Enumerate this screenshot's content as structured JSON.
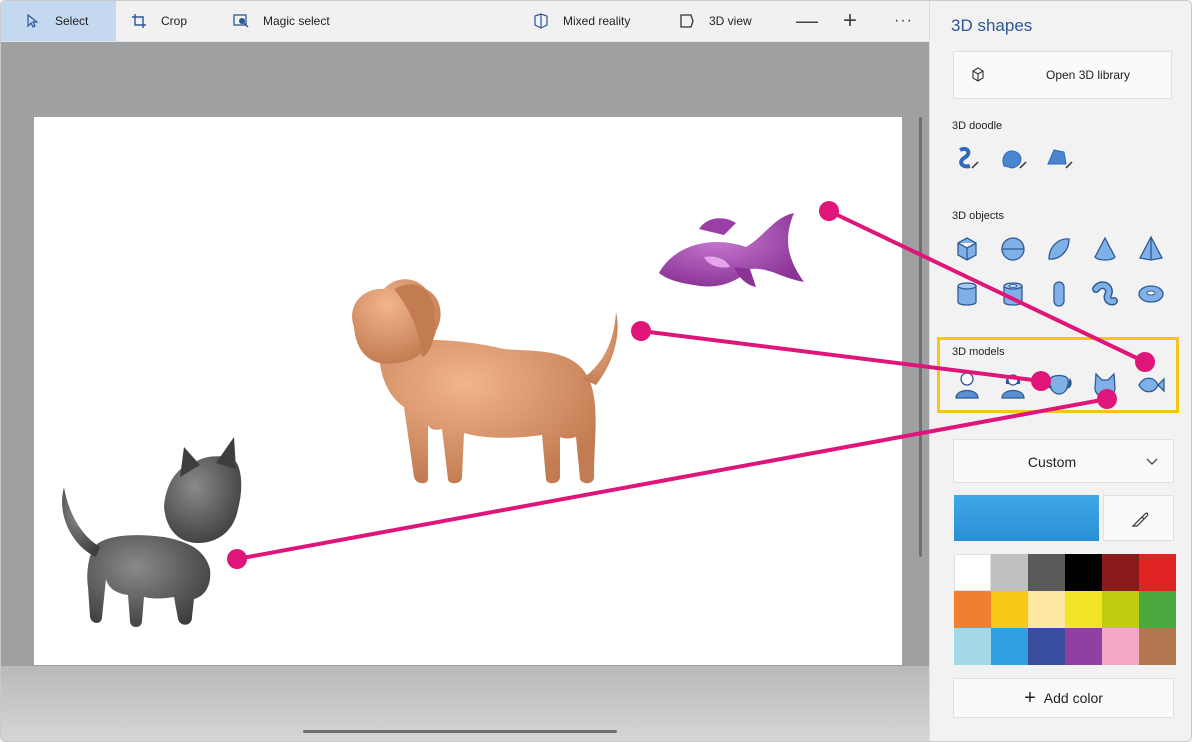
{
  "toolbar": {
    "select_label": "Select",
    "crop_label": "Crop",
    "magic_select_label": "Magic select",
    "mixed_reality_label": "Mixed reality",
    "view_3d_label": "3D view",
    "zoom_out_label": "—",
    "zoom_in_label": "+",
    "more_label": "···"
  },
  "panel": {
    "title": "3D shapes",
    "open_library_label": "Open 3D library",
    "section_doodle": "3D doodle",
    "section_objects": "3D objects",
    "section_models": "3D models",
    "doodle_items": [
      "sharp-doodle-icon",
      "soft-doodle-icon",
      "tube-doodle-icon"
    ],
    "object_items": [
      "cube-icon",
      "sphere-icon",
      "hemisphere-icon",
      "cone-icon",
      "pyramid-icon",
      "cylinder-icon",
      "tube-icon",
      "capsule-icon",
      "curved-tube-icon",
      "donut-icon"
    ],
    "model_items": [
      "man-model-icon",
      "woman-model-icon",
      "dog-model-icon",
      "cat-model-icon",
      "fish-model-icon"
    ],
    "color_mode": "Custom",
    "current_color": "#2a8fd6",
    "palette": [
      "#ffffff",
      "#c0c0c0",
      "#5a5a5a",
      "#000000",
      "#8b1a1a",
      "#e02424",
      "#f08030",
      "#f8c818",
      "#fce8a0",
      "#f4e428",
      "#c0cc10",
      "#4aaa40",
      "#a4d8e4",
      "#30a0e0",
      "#3a4ea0",
      "#9040a0",
      "#f4a8c8",
      "#b47850"
    ],
    "add_color_label": "Add color"
  },
  "canvas": {
    "models": [
      "cat",
      "dog",
      "fish"
    ],
    "annotation_color": "#e0157a"
  }
}
